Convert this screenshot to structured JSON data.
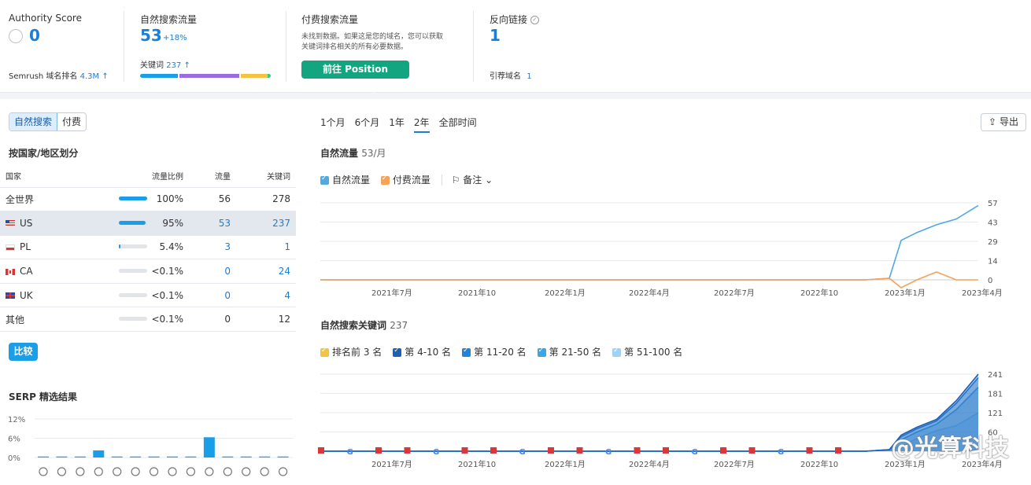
{
  "overview": {
    "authority": {
      "label": "Authority Score",
      "value": "0",
      "rank_label": "Semrush 域名排名",
      "rank_value": "4.3M ↑"
    },
    "organic": {
      "label": "自然搜索流量",
      "value": "53",
      "change": "+18%",
      "kw_label": "关键词",
      "kw_value": "237 ↑"
    },
    "paid": {
      "label": "付费搜索流量",
      "desc1": "未找到数据。如果这是您的域名，您可以获取",
      "desc2": "关键词排名相关的所有必要数据。",
      "button": "前往 Position Tracking"
    },
    "backlinks": {
      "label": "反向链接",
      "value": "1",
      "ref_label": "引荐域名",
      "ref_value": "1"
    }
  },
  "toggle": {
    "organic": "自然搜索",
    "paid": "付费"
  },
  "geo": {
    "title": "按国家/地区划分",
    "headers": [
      "国家",
      "流量比例",
      "流量",
      "关键词"
    ],
    "rows": [
      {
        "name": "全世界",
        "pct": "100%",
        "share": 1.0,
        "traffic": "56",
        "kw": "278",
        "flag": ""
      },
      {
        "name": "US",
        "pct": "95%",
        "share": 0.95,
        "traffic": "53",
        "kw": "237",
        "flag": "us"
      },
      {
        "name": "PL",
        "pct": "5.4%",
        "share": 0.054,
        "traffic": "3",
        "kw": "1",
        "flag": "pl"
      },
      {
        "name": "CA",
        "pct": "<0.1%",
        "share": 0.0,
        "traffic": "0",
        "kw": "24",
        "flag": "ca"
      },
      {
        "name": "UK",
        "pct": "<0.1%",
        "share": 0.0,
        "traffic": "0",
        "kw": "4",
        "flag": "uk"
      },
      {
        "name": "其他",
        "pct": "<0.1%",
        "share": 0.0,
        "traffic": "0",
        "kw": "12",
        "flag": ""
      }
    ],
    "compare": "比较"
  },
  "serp": {
    "title": "SERP 精选结果",
    "ticks": [
      "12%",
      "6%",
      "0%"
    ],
    "values": [
      0.3,
      0.3,
      0.3,
      2.2,
      0.3,
      0.3,
      0.3,
      0.3,
      0.3,
      6.3,
      0.3,
      0.3,
      0.3,
      0.3
    ],
    "icons": [
      "graduation-icon",
      "pin-icon",
      "doc-icon",
      "image-pack-icon",
      "link-icon",
      "star-icon",
      "video-icon",
      "play-icon",
      "trophy-icon",
      "image-icon",
      "shop-icon",
      "video2-icon",
      "flag-icon",
      "question-icon"
    ]
  },
  "periods": [
    "1个月",
    "6个月",
    "1年",
    "2年",
    "全部时间"
  ],
  "active_period": "2年",
  "export": "导出",
  "traffic_chart": {
    "title": "自然流量",
    "subtitle": "53/月",
    "legend": [
      "自然流量",
      "付费流量"
    ],
    "notes": "备注",
    "colors": {
      "organic": "#52a8e0",
      "paid": "#f3a35b"
    }
  },
  "keywords_chart": {
    "title": "自然搜索关键词",
    "count": "237",
    "legend": [
      "排名前 3 名",
      "第 4-10 名",
      "第 11-20 名",
      "第 21-50 名",
      "第 51-100 名"
    ],
    "colors": [
      "#f5c242",
      "#1f5fb5",
      "#2382d9",
      "#3aa6e8",
      "#9fd2f5"
    ]
  },
  "chart_data": [
    {
      "type": "line",
      "title": "自然流量",
      "x": [
        "2021年7月",
        "2021年10",
        "2022年1月",
        "2022年4月",
        "2022年7月",
        "2022年10",
        "2023年1月",
        "2023年4月"
      ],
      "series": [
        {
          "name": "自然流量",
          "values": [
            0,
            0,
            0,
            0,
            0,
            0,
            35,
            55
          ]
        },
        {
          "name": "付费流量",
          "values": [
            0,
            0,
            0,
            0,
            0,
            0,
            0,
            0
          ]
        }
      ],
      "yticks": [
        "57",
        "43",
        "29",
        "14",
        "0"
      ],
      "ylim": [
        0,
        57
      ]
    },
    {
      "type": "area",
      "title": "自然搜索关键词",
      "x": [
        "2021年7月",
        "2021年10",
        "2022年1月",
        "2022年4月",
        "2022年7月",
        "2022年10",
        "2023年1月",
        "2023年4月"
      ],
      "series": [
        {
          "name": "第 51-100 名",
          "values": [
            0,
            0,
            0,
            0,
            0,
            0,
            40,
            120
          ]
        },
        {
          "name": "第 21-50 名",
          "values": [
            0,
            0,
            0,
            0,
            0,
            0,
            60,
            200
          ]
        },
        {
          "name": "第 11-20 名",
          "values": [
            0,
            0,
            0,
            0,
            0,
            0,
            70,
            230
          ]
        },
        {
          "name": "第 4-10 名",
          "values": [
            0,
            0,
            0,
            0,
            0,
            0,
            75,
            241
          ]
        }
      ],
      "yticks": [
        "241",
        "181",
        "121",
        "60"
      ],
      "ylim": [
        0,
        241
      ]
    }
  ],
  "xlabels": [
    "2021年7月",
    "2021年10",
    "2022年1月",
    "2022年4月",
    "2022年7月",
    "2022年10",
    "2023年1月",
    "2023年4月"
  ],
  "watermark": "@光算科技"
}
